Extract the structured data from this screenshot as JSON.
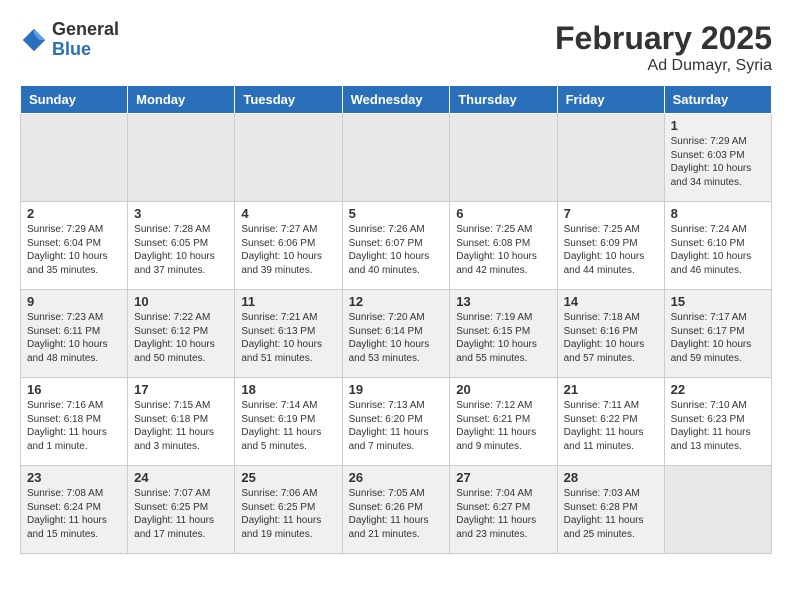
{
  "logo": {
    "general": "General",
    "blue": "Blue"
  },
  "title": "February 2025",
  "subtitle": "Ad Dumayr, Syria",
  "weekdays": [
    "Sunday",
    "Monday",
    "Tuesday",
    "Wednesday",
    "Thursday",
    "Friday",
    "Saturday"
  ],
  "weeks": [
    [
      {
        "day": "",
        "info": ""
      },
      {
        "day": "",
        "info": ""
      },
      {
        "day": "",
        "info": ""
      },
      {
        "day": "",
        "info": ""
      },
      {
        "day": "",
        "info": ""
      },
      {
        "day": "",
        "info": ""
      },
      {
        "day": "1",
        "info": "Sunrise: 7:29 AM\nSunset: 6:03 PM\nDaylight: 10 hours\nand 34 minutes."
      }
    ],
    [
      {
        "day": "2",
        "info": "Sunrise: 7:29 AM\nSunset: 6:04 PM\nDaylight: 10 hours\nand 35 minutes."
      },
      {
        "day": "3",
        "info": "Sunrise: 7:28 AM\nSunset: 6:05 PM\nDaylight: 10 hours\nand 37 minutes."
      },
      {
        "day": "4",
        "info": "Sunrise: 7:27 AM\nSunset: 6:06 PM\nDaylight: 10 hours\nand 39 minutes."
      },
      {
        "day": "5",
        "info": "Sunrise: 7:26 AM\nSunset: 6:07 PM\nDaylight: 10 hours\nand 40 minutes."
      },
      {
        "day": "6",
        "info": "Sunrise: 7:25 AM\nSunset: 6:08 PM\nDaylight: 10 hours\nand 42 minutes."
      },
      {
        "day": "7",
        "info": "Sunrise: 7:25 AM\nSunset: 6:09 PM\nDaylight: 10 hours\nand 44 minutes."
      },
      {
        "day": "8",
        "info": "Sunrise: 7:24 AM\nSunset: 6:10 PM\nDaylight: 10 hours\nand 46 minutes."
      }
    ],
    [
      {
        "day": "9",
        "info": "Sunrise: 7:23 AM\nSunset: 6:11 PM\nDaylight: 10 hours\nand 48 minutes."
      },
      {
        "day": "10",
        "info": "Sunrise: 7:22 AM\nSunset: 6:12 PM\nDaylight: 10 hours\nand 50 minutes."
      },
      {
        "day": "11",
        "info": "Sunrise: 7:21 AM\nSunset: 6:13 PM\nDaylight: 10 hours\nand 51 minutes."
      },
      {
        "day": "12",
        "info": "Sunrise: 7:20 AM\nSunset: 6:14 PM\nDaylight: 10 hours\nand 53 minutes."
      },
      {
        "day": "13",
        "info": "Sunrise: 7:19 AM\nSunset: 6:15 PM\nDaylight: 10 hours\nand 55 minutes."
      },
      {
        "day": "14",
        "info": "Sunrise: 7:18 AM\nSunset: 6:16 PM\nDaylight: 10 hours\nand 57 minutes."
      },
      {
        "day": "15",
        "info": "Sunrise: 7:17 AM\nSunset: 6:17 PM\nDaylight: 10 hours\nand 59 minutes."
      }
    ],
    [
      {
        "day": "16",
        "info": "Sunrise: 7:16 AM\nSunset: 6:18 PM\nDaylight: 11 hours\nand 1 minute."
      },
      {
        "day": "17",
        "info": "Sunrise: 7:15 AM\nSunset: 6:18 PM\nDaylight: 11 hours\nand 3 minutes."
      },
      {
        "day": "18",
        "info": "Sunrise: 7:14 AM\nSunset: 6:19 PM\nDaylight: 11 hours\nand 5 minutes."
      },
      {
        "day": "19",
        "info": "Sunrise: 7:13 AM\nSunset: 6:20 PM\nDaylight: 11 hours\nand 7 minutes."
      },
      {
        "day": "20",
        "info": "Sunrise: 7:12 AM\nSunset: 6:21 PM\nDaylight: 11 hours\nand 9 minutes."
      },
      {
        "day": "21",
        "info": "Sunrise: 7:11 AM\nSunset: 6:22 PM\nDaylight: 11 hours\nand 11 minutes."
      },
      {
        "day": "22",
        "info": "Sunrise: 7:10 AM\nSunset: 6:23 PM\nDaylight: 11 hours\nand 13 minutes."
      }
    ],
    [
      {
        "day": "23",
        "info": "Sunrise: 7:08 AM\nSunset: 6:24 PM\nDaylight: 11 hours\nand 15 minutes."
      },
      {
        "day": "24",
        "info": "Sunrise: 7:07 AM\nSunset: 6:25 PM\nDaylight: 11 hours\nand 17 minutes."
      },
      {
        "day": "25",
        "info": "Sunrise: 7:06 AM\nSunset: 6:25 PM\nDaylight: 11 hours\nand 19 minutes."
      },
      {
        "day": "26",
        "info": "Sunrise: 7:05 AM\nSunset: 6:26 PM\nDaylight: 11 hours\nand 21 minutes."
      },
      {
        "day": "27",
        "info": "Sunrise: 7:04 AM\nSunset: 6:27 PM\nDaylight: 11 hours\nand 23 minutes."
      },
      {
        "day": "28",
        "info": "Sunrise: 7:03 AM\nSunset: 6:28 PM\nDaylight: 11 hours\nand 25 minutes."
      },
      {
        "day": "",
        "info": ""
      }
    ]
  ]
}
